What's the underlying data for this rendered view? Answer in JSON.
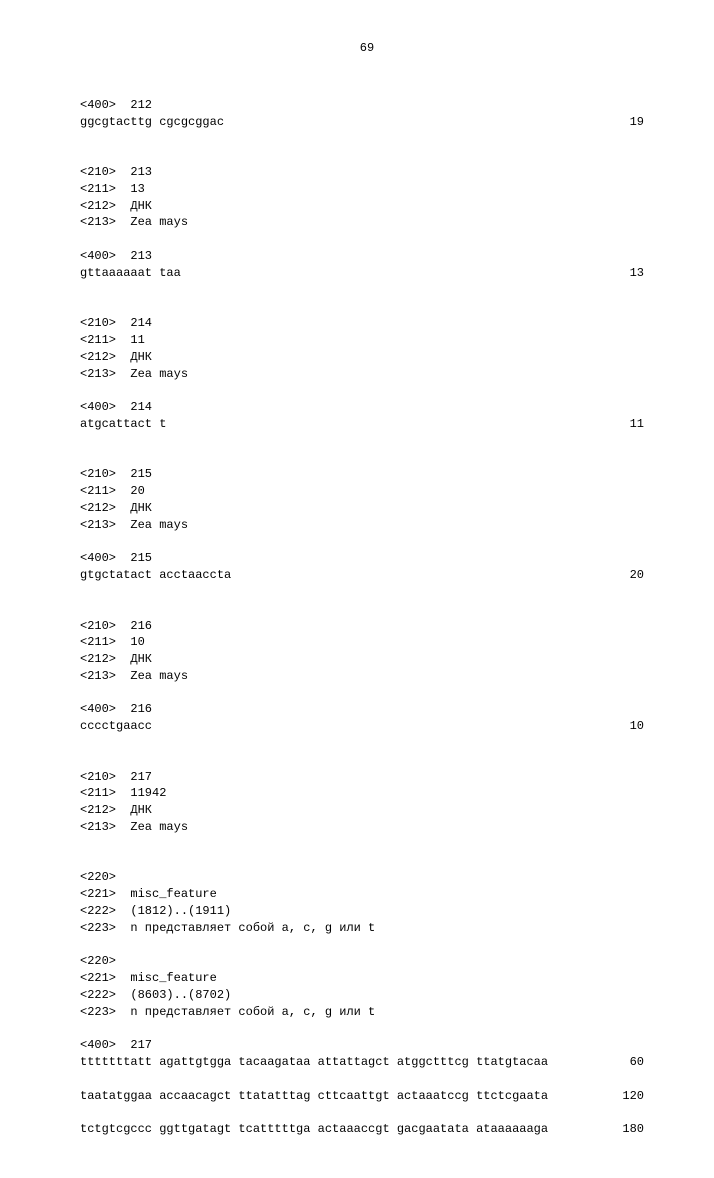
{
  "page_number": "69",
  "entries": [
    {
      "type": "tag",
      "tag": "<400>",
      "value": "212"
    },
    {
      "type": "seq",
      "text": "ggcgtacttg cgcgcggac",
      "count": "19"
    },
    {
      "type": "blank2"
    },
    {
      "type": "tag",
      "tag": "<210>",
      "value": "213"
    },
    {
      "type": "tag",
      "tag": "<211>",
      "value": "13"
    },
    {
      "type": "tag",
      "tag": "<212>",
      "value": "ДНК"
    },
    {
      "type": "tag",
      "tag": "<213>",
      "value": "Zea mays"
    },
    {
      "type": "blank"
    },
    {
      "type": "tag",
      "tag": "<400>",
      "value": "213"
    },
    {
      "type": "seq",
      "text": "gttaaaaaat taa",
      "count": "13"
    },
    {
      "type": "blank2"
    },
    {
      "type": "tag",
      "tag": "<210>",
      "value": "214"
    },
    {
      "type": "tag",
      "tag": "<211>",
      "value": "11"
    },
    {
      "type": "tag",
      "tag": "<212>",
      "value": "ДНК"
    },
    {
      "type": "tag",
      "tag": "<213>",
      "value": "Zea mays"
    },
    {
      "type": "blank"
    },
    {
      "type": "tag",
      "tag": "<400>",
      "value": "214"
    },
    {
      "type": "seq",
      "text": "atgcattact t",
      "count": "11"
    },
    {
      "type": "blank2"
    },
    {
      "type": "tag",
      "tag": "<210>",
      "value": "215"
    },
    {
      "type": "tag",
      "tag": "<211>",
      "value": "20"
    },
    {
      "type": "tag",
      "tag": "<212>",
      "value": "ДНК"
    },
    {
      "type": "tag",
      "tag": "<213>",
      "value": "Zea mays"
    },
    {
      "type": "blank"
    },
    {
      "type": "tag",
      "tag": "<400>",
      "value": "215"
    },
    {
      "type": "seq",
      "text": "gtgctatact acctaaccta",
      "count": "20"
    },
    {
      "type": "blank2"
    },
    {
      "type": "tag",
      "tag": "<210>",
      "value": "216"
    },
    {
      "type": "tag",
      "tag": "<211>",
      "value": "10"
    },
    {
      "type": "tag",
      "tag": "<212>",
      "value": "ДНК"
    },
    {
      "type": "tag",
      "tag": "<213>",
      "value": "Zea mays"
    },
    {
      "type": "blank"
    },
    {
      "type": "tag",
      "tag": "<400>",
      "value": "216"
    },
    {
      "type": "seq",
      "text": "cccctgaacc",
      "count": "10"
    },
    {
      "type": "blank2"
    },
    {
      "type": "tag",
      "tag": "<210>",
      "value": "217"
    },
    {
      "type": "tag",
      "tag": "<211>",
      "value": "11942"
    },
    {
      "type": "tag",
      "tag": "<212>",
      "value": "ДНК"
    },
    {
      "type": "tag",
      "tag": "<213>",
      "value": "Zea mays"
    },
    {
      "type": "blank2"
    },
    {
      "type": "tag",
      "tag": "<220>",
      "value": ""
    },
    {
      "type": "tag",
      "tag": "<221>",
      "value": "misc_feature"
    },
    {
      "type": "tag",
      "tag": "<222>",
      "value": "(1812)..(1911)"
    },
    {
      "type": "tag",
      "tag": "<223>",
      "value": "n представляет собой a, c, g или t"
    },
    {
      "type": "blank"
    },
    {
      "type": "tag",
      "tag": "<220>",
      "value": ""
    },
    {
      "type": "tag",
      "tag": "<221>",
      "value": "misc_feature"
    },
    {
      "type": "tag",
      "tag": "<222>",
      "value": "(8603)..(8702)"
    },
    {
      "type": "tag",
      "tag": "<223>",
      "value": "n представляет собой a, c, g или t"
    },
    {
      "type": "blank"
    },
    {
      "type": "tag",
      "tag": "<400>",
      "value": "217"
    },
    {
      "type": "seq",
      "text": "tttttttatt agattgtgga tacaagataa attattagct atggctttcg ttatgtacaa",
      "count": "60"
    },
    {
      "type": "blank"
    },
    {
      "type": "seq",
      "text": "taatatggaa accaacagct ttatatttag cttcaattgt actaaatccg ttctcgaata",
      "count": "120"
    },
    {
      "type": "blank"
    },
    {
      "type": "seq",
      "text": "tctgtcgccc ggttgatagt tcatttttga actaaaccgt gacgaatata ataaaaaaga",
      "count": "180"
    }
  ]
}
